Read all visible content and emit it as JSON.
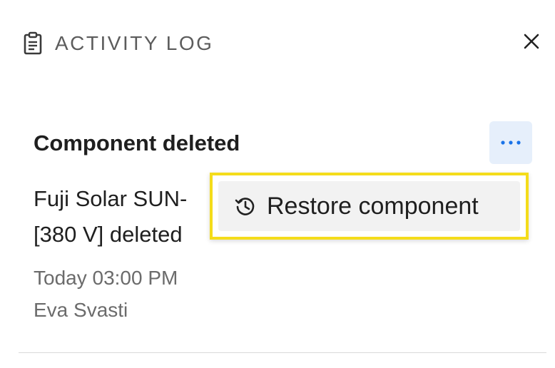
{
  "header": {
    "title": "ACTIVITY LOG",
    "icon": "clipboard-icon",
    "close_icon": "close-icon"
  },
  "entry": {
    "title": "Component deleted",
    "description": "Fuji Solar SUN-... [380 V] deleted ...",
    "description_line1": "Fuji Solar SUN-",
    "description_line2": "[380 V] deleted",
    "time": "Today 03:00 PM",
    "user": "Eva Svasti",
    "more_icon": "more-horizontal-icon"
  },
  "menu": {
    "items": [
      {
        "label": "Restore component",
        "icon": "history-icon"
      }
    ]
  },
  "colors": {
    "accent": "#1a73e8",
    "highlight_border": "#f4dc1a",
    "more_bg": "#e6effb"
  }
}
